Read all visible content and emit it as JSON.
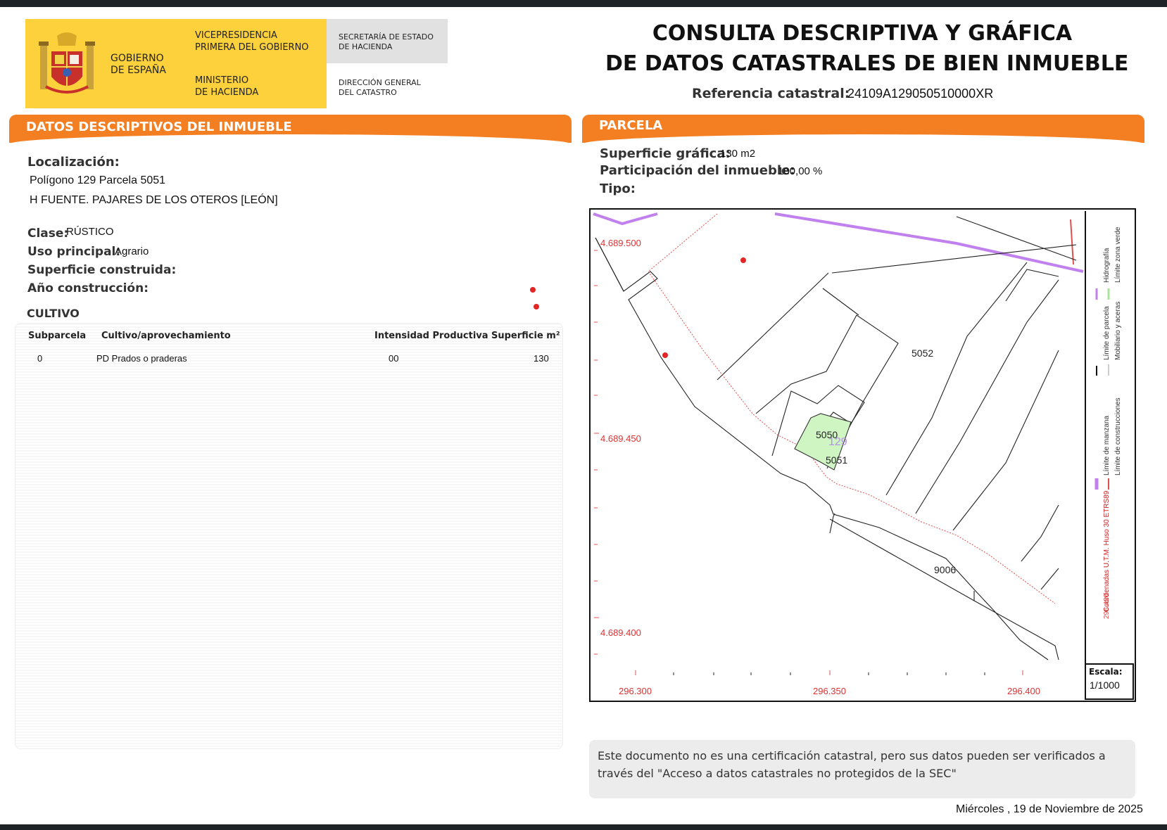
{
  "header": {
    "gobierno": "GOBIERNO\nDE ESPAÑA",
    "vicepresidencia": "VICEPRESIDENCIA\nPRIMERA DEL GOBIERNO",
    "ministerio": "MINISTERIO\nDE HACIENDA",
    "secretaria": "SECRETARÍA DE ESTADO\nDE HACIENDA",
    "direccion": "DIRECCIÓN GENERAL\nDEL CATASTRO",
    "title": "CONSULTA DESCRIPTIVA Y GRÁFICA\nDE DATOS CATASTRALES DE BIEN INMUEBLE",
    "referencia_label": "Referencia catastral:",
    "referencia_value": "24109A129050510000XR"
  },
  "datos": {
    "section_title": "DATOS DESCRIPTIVOS DEL INMUEBLE",
    "localizacion_label": "Localización:",
    "localizacion_line1": "Polígono 129 Parcela 5051",
    "localizacion_line2": "H FUENTE. PAJARES DE LOS OTEROS [LEÓN]",
    "clase_label": "Clase:",
    "clase_value": "RÚSTICO",
    "uso_label": "Uso principal:",
    "uso_value": "Agrario",
    "superficie_construida_label": "Superficie construida:",
    "anio_label": "Año construcción:"
  },
  "cultivo": {
    "title": "CULTIVO",
    "columns": [
      "Subparcela",
      "Cultivo/aprovechamiento",
      "Intensidad Productiva",
      "Superficie m²"
    ],
    "rows": [
      {
        "subparcela": "0",
        "cultivo": "PD Prados o praderas",
        "intensidad": "00",
        "superficie": "130"
      }
    ]
  },
  "parcela": {
    "section_title": "PARCELA",
    "superficie_label": "Superficie gráfica:",
    "superficie_value": "130 m2",
    "participacion_label": "Participación del inmueble:",
    "participacion_value": "100,00 %",
    "tipo_label": "Tipo:"
  },
  "map": {
    "y_labels": [
      "4.689.500",
      "4.689.450",
      "4.689.400"
    ],
    "x_labels": [
      "296.300",
      "296.350",
      "296.400"
    ],
    "parcels": [
      "5052",
      "5050",
      "129",
      "5051",
      "9006"
    ],
    "legend": {
      "col1": [
        "Hidrografía",
        "Límite de parcela",
        "Límite de manzana"
      ],
      "col2": [
        "Límite zona verde",
        "Mobiliario y aceras",
        "Límite de construcciones"
      ],
      "coords": "Coordenadas U.T.M. Huso 30 ETRS89",
      "coords_num": "296.400"
    },
    "scale_label": "Escala:",
    "scale_value": "1/1000",
    "colors": {
      "hydro": "#c080ee",
      "green": "#cff5c2",
      "red": "#e05050"
    }
  },
  "note": "Este documento no es una certificación catastral, pero sus datos pueden ser verificados a través del \"Acceso a datos catastrales no protegidos de la SEC\"",
  "date": "Miércoles , 19 de Noviembre de 2025"
}
